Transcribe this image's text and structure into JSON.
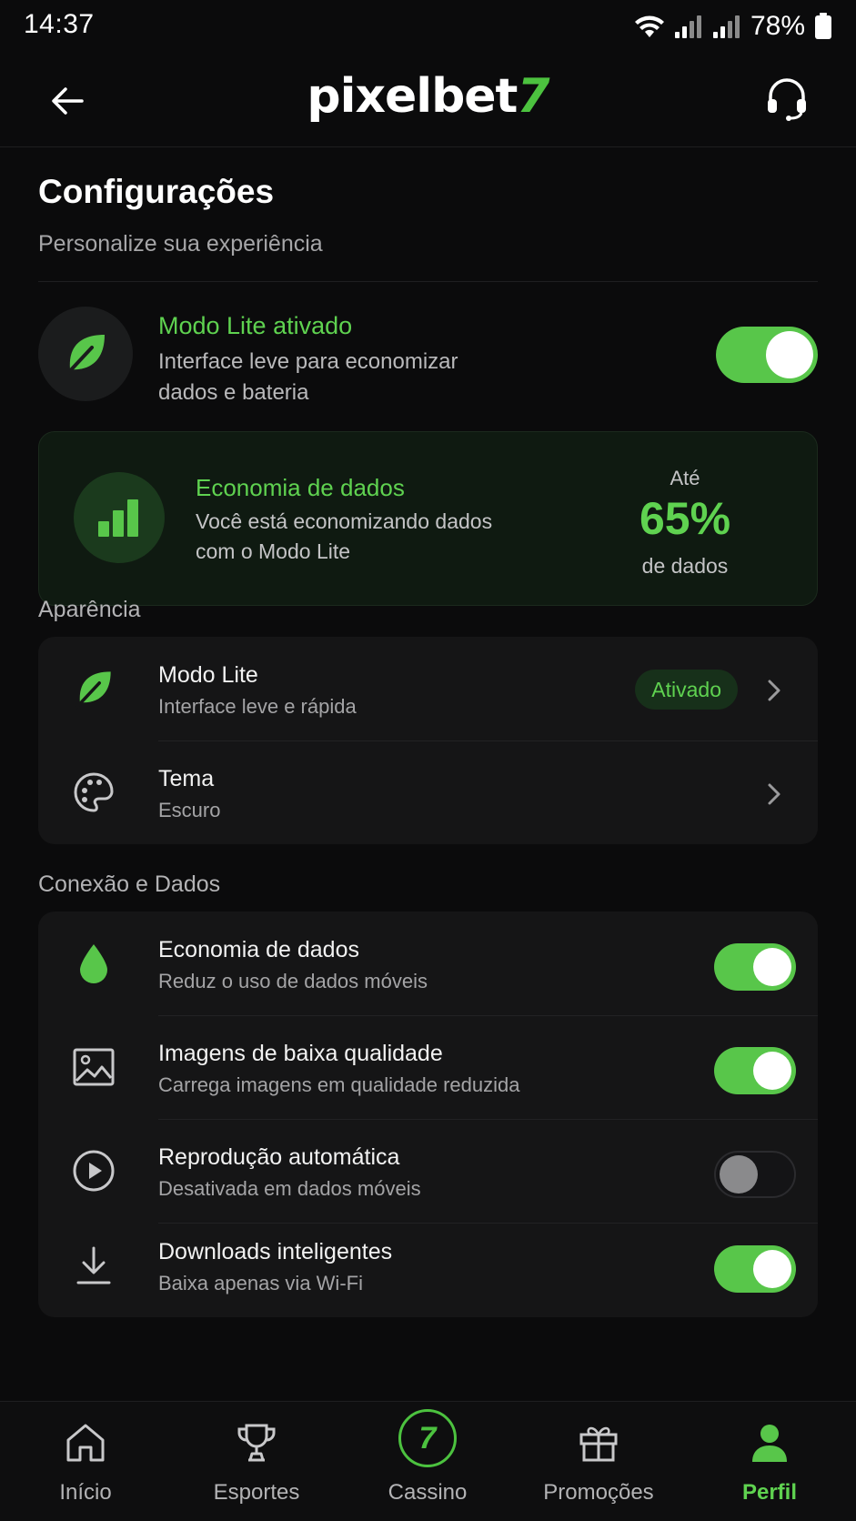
{
  "status_bar": {
    "time": "14:37",
    "battery": "78%"
  },
  "header": {
    "logo_text": "pixelbet",
    "logo_number": "7"
  },
  "page": {
    "title": "Configurações",
    "subtitle": "Personalize sua experiência"
  },
  "lite_mode": {
    "title": "Modo Lite ativado",
    "description": "Interface leve para economizar dados e bateria",
    "enabled": true
  },
  "savings": {
    "title": "Economia de dados",
    "description": "Você está economizando dados com o Modo Lite",
    "prefix": "Até",
    "percent": "65%",
    "suffix": "de dados"
  },
  "appearance": {
    "label": "Aparência",
    "items": [
      {
        "title": "Modo Lite",
        "subtitle": "Interface leve e rápida",
        "badge": "Ativado"
      },
      {
        "title": "Tema",
        "subtitle": "Escuro"
      }
    ]
  },
  "connection": {
    "label": "Conexão e Dados",
    "items": [
      {
        "title": "Economia de dados",
        "subtitle": "Reduz o uso de dados móveis",
        "enabled": true
      },
      {
        "title": "Imagens de baixa qualidade",
        "subtitle": "Carrega imagens em qualidade reduzida",
        "enabled": true
      },
      {
        "title": "Reprodução automática",
        "subtitle": "Desativada em dados móveis",
        "enabled": false
      },
      {
        "title": "Downloads inteligentes",
        "subtitle": "Baixa apenas via Wi-Fi",
        "enabled": true
      }
    ]
  },
  "nav": {
    "items": [
      {
        "label": "Início"
      },
      {
        "label": "Esportes"
      },
      {
        "label": "Cassino",
        "icon_text": "7"
      },
      {
        "label": "Promoções"
      },
      {
        "label": "Perfil",
        "active": true
      }
    ]
  },
  "colors": {
    "accent": "#5fd250",
    "background": "#0b0b0c",
    "card": "#151516"
  }
}
